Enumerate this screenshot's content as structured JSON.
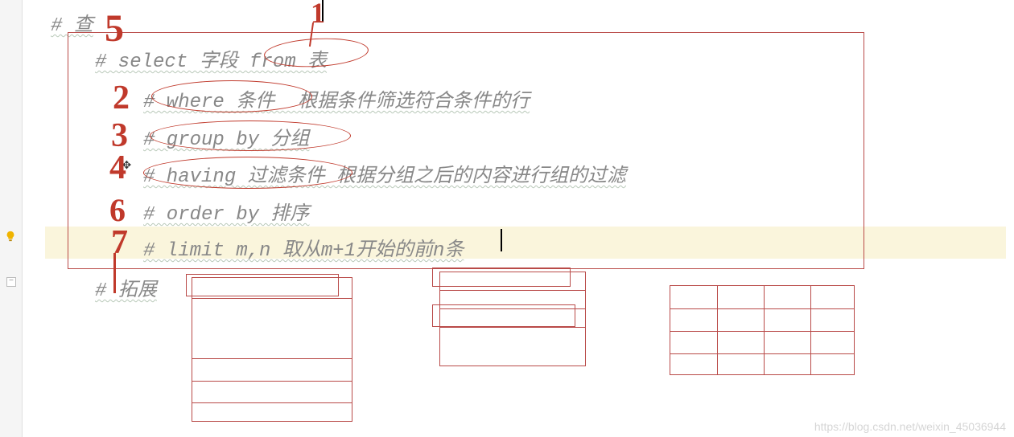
{
  "code": {
    "line1": "# 查",
    "line2": "# select 字段 from 表",
    "line3": "# where 条件  根据条件筛选符合条件的行",
    "line4": "# group by 分组",
    "line5": "# having 过滤条件 根据分组之后的内容进行组的过滤",
    "line6": "# order by 排序",
    "line7": "# limit m,n 取从m+1开始的前n条",
    "line8": "# 拓展"
  },
  "annotations": {
    "n1": "1",
    "n2": "2",
    "n3": "3",
    "n4": "4",
    "n5": "5",
    "n6": "6",
    "n7": "7"
  },
  "gutter": {
    "fold_symbol": "−"
  },
  "watermark": "https://blog.csdn.net/weixin_45036944"
}
